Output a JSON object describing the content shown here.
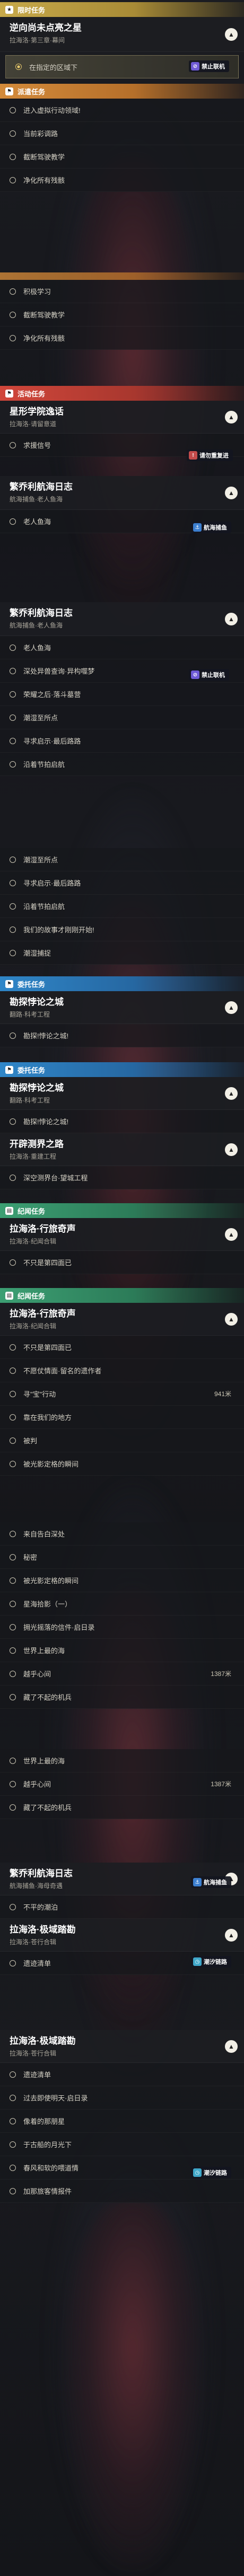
{
  "sections": {
    "limited": "限时任务",
    "daily": "派遣任务",
    "event": "活动任务",
    "world1": "委托任务",
    "world2": "委托任务",
    "legend": "纪闻任务",
    "legend2": "纪闻任务"
  },
  "badges": {
    "no_coop": "禁止联机",
    "cannot_enter": "请勿重复进",
    "sailing": "航海捕鱼",
    "time_limit": "潮汐链路"
  },
  "cards": {
    "c1": {
      "title": "逆向尚未点亮之星",
      "sub": "拉海洛·第三章·幕间"
    },
    "c2": {
      "title": "星形学院逸话",
      "sub": "拉海洛·请留意道"
    },
    "c3": {
      "title": "繁乔利航海日志",
      "sub": "航海捕鱼·老人鱼海"
    },
    "c4": {
      "title": "繁乔利航海日志",
      "sub": "航海捕鱼·老人鱼海"
    },
    "c5": {
      "title": "勘探悖论之城",
      "sub": "翻路·科考工程"
    },
    "c6": {
      "title": "勘探悖论之城",
      "sub": "翻路·科考工程"
    },
    "c7": {
      "title": "开辟测界之路",
      "sub": "拉海洛·重建工程"
    },
    "c8": {
      "title": "拉海洛·行旅奇声",
      "sub": "拉海洛·纪闻合辑"
    },
    "c9": {
      "title": "拉海洛·行旅奇声",
      "sub": "拉海洛·纪闻合辑"
    },
    "c10": {
      "title": "繁乔利航海日志",
      "sub": "航海捕鱼·海母奇遇"
    },
    "c11": {
      "title": "拉海洛·极域踏勘",
      "sub": "拉海洛·苍行合辑"
    },
    "c12": {
      "title": "拉海洛·极域踏勘",
      "sub": "拉海洛·苍行合辑"
    }
  },
  "steps": {
    "s1": "在指定的区域下",
    "s2": "进入虚拟行动领域!",
    "s3": "当前彩调路",
    "s4": "截断驾驶教学",
    "s5": "净化所有残骸",
    "s6": "积极学习",
    "s7": "截断驾驶教学",
    "s8": "净化所有残骸",
    "s9": "求援信号",
    "s10": "老人鱼海",
    "s11": "老人鱼海",
    "s12": "深处异兽查询·异构噬梦",
    "s13": "荣耀之后·落斗墓营",
    "s14": "潮湿至所点",
    "s15": "寻求启示·最后路路",
    "s16": "沿着节拍启航",
    "s17": "潮湿至所点",
    "s18": "寻求启示·最后路路",
    "s19": "沿着节拍启航",
    "s20": "我们的故事才刚刚开始!",
    "s21": "潮湿捕捉",
    "s22": "勘探!悖论之城!",
    "s23": "勘探!悖论之城!",
    "s24": "深空测界台·望城工程",
    "s25": "不只是第四面已",
    "s26": "不只是第四面已",
    "s27": "不愿仗情面·留名的遗作者",
    "s28": "寻\"宝\"行动",
    "s29": "靠在我们的地方",
    "s30": "被判",
    "s31": "被光影定格的瞬间",
    "s32": "来自告白深处",
    "s33": "秘密",
    "s34": "被光影定格的瞬间",
    "s35": "星海拾影（一）",
    "s36": "拥光摇落的信件·启日录",
    "s37": "世界上最的海",
    "s38": "越乎心间",
    "s39": "藏了不起的机兵",
    "s40": "世界上最的海",
    "s41": "越乎心间",
    "s42": "藏了不起的机兵",
    "s43": "不平的潮泊",
    "s44": "遗迹清单",
    "s45": "遗迹清单",
    "s46": "过去即使明天·启日录",
    "s47": "像着的那朋星",
    "s48": "于古船的月光下",
    "s49": "春风和软的喂道情",
    "s50": "加那旅客情报件"
  },
  "distances": {
    "d1": "941米",
    "d2": "1387米",
    "d3": "1387米"
  }
}
